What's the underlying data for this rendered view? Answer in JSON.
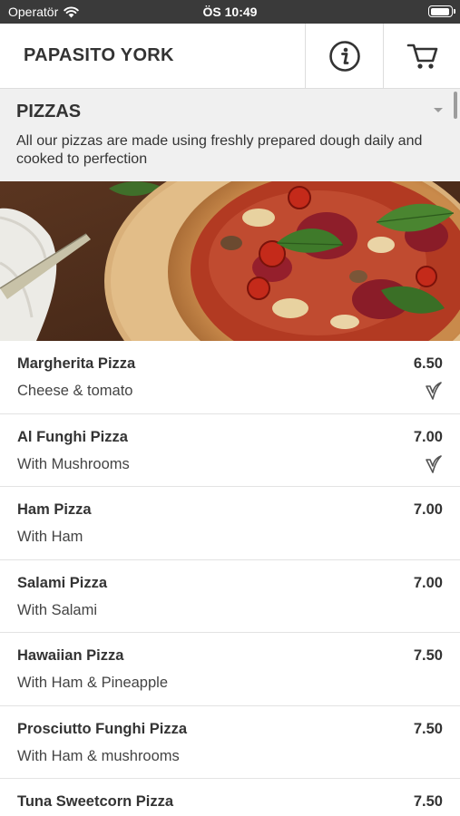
{
  "status_bar": {
    "carrier": "Operatör",
    "time": "ÖS 10:49",
    "battery_level": 0.95
  },
  "header": {
    "title": "PAPASITO YORK",
    "info_icon": "info-circle-icon",
    "cart_icon": "shopping-cart-icon"
  },
  "category": {
    "title": "PIZZAS",
    "description": "All our pizzas are made using freshly prepared dough daily and cooked to perfection",
    "expand_icon": "chevron-down-icon"
  },
  "hero_image": {
    "subject": "pizza with salami, basil and tomatoes on a wooden board"
  },
  "colors": {
    "status_bar": "#3a3a3a",
    "category_background": "#f0f0f0",
    "divider": "#e3e3e3",
    "text": "#333333"
  },
  "menu": {
    "items": [
      {
        "name": "Margherita Pizza",
        "description": "Cheese & tomato",
        "price": "6.50",
        "vegetarian": true
      },
      {
        "name": "Al Funghi Pizza",
        "description": "With Mushrooms",
        "price": "7.00",
        "vegetarian": true
      },
      {
        "name": "Ham Pizza",
        "description": "With Ham",
        "price": "7.00",
        "vegetarian": false
      },
      {
        "name": "Salami Pizza",
        "description": "With Salami",
        "price": "7.00",
        "vegetarian": false
      },
      {
        "name": "Hawaiian Pizza",
        "description": "With Ham & Pineapple",
        "price": "7.50",
        "vegetarian": false
      },
      {
        "name": "Prosciutto Funghi Pizza",
        "description": "With Ham & mushrooms",
        "price": "7.50",
        "vegetarian": false
      },
      {
        "name": "Tuna Sweetcorn Pizza",
        "description": "",
        "price": "7.50",
        "vegetarian": false
      }
    ]
  }
}
